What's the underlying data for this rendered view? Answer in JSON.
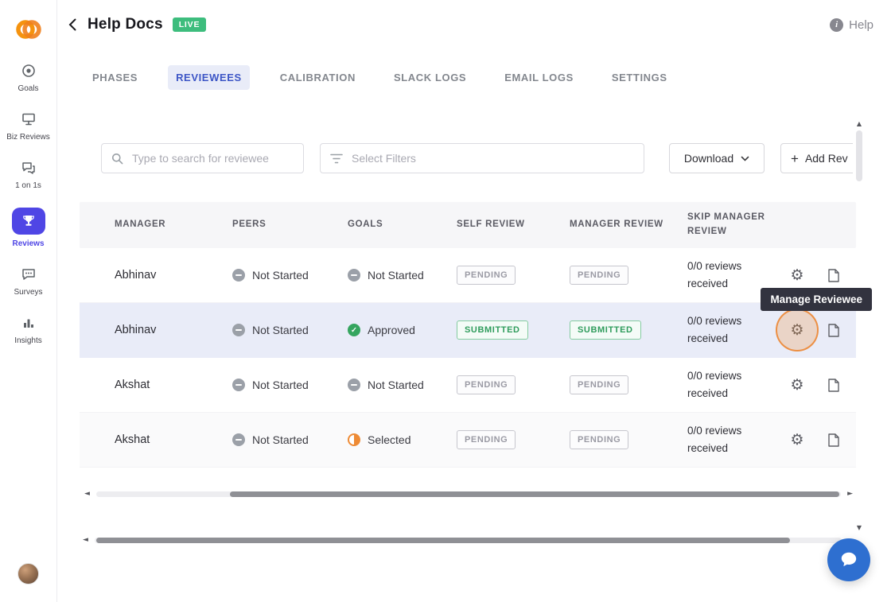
{
  "colors": {
    "nav-active": "#4f46e5",
    "tab-active": "#3d56c6",
    "live-green": "#3dbd7d",
    "submitted-green": "#2f9c5c",
    "highlight-orange": "#ee8b35",
    "chat-blue": "#2e6fd0",
    "logo-orange": "#f0851d"
  },
  "icons": {
    "gear": "⚙",
    "plus": "+",
    "info": "i",
    "scroll_up": "▲",
    "scroll_down": "▼",
    "scroll_left": "◄",
    "scroll_right": "►"
  },
  "sidebar": {
    "items": [
      {
        "label": "Goals",
        "active": false
      },
      {
        "label": "Biz Reviews",
        "active": false
      },
      {
        "label": "1 on 1s",
        "active": false
      },
      {
        "label": "Reviews",
        "active": true
      },
      {
        "label": "Surveys",
        "active": false
      },
      {
        "label": "Insights",
        "active": false
      }
    ]
  },
  "header": {
    "title": "Help Docs",
    "live_badge": "LIVE",
    "help_label": "Help"
  },
  "tabs": [
    {
      "label": "PHASES",
      "active": false
    },
    {
      "label": "REVIEWEES",
      "active": true
    },
    {
      "label": "CALIBRATION",
      "active": false
    },
    {
      "label": "SLACK LOGS",
      "active": false
    },
    {
      "label": "EMAIL LOGS",
      "active": false
    },
    {
      "label": "SETTINGS",
      "active": false
    }
  ],
  "toolbar": {
    "search_placeholder": "Type to search for reviewee",
    "filter_placeholder": "Select Filters",
    "download_label": "Download",
    "add_reviewee_label": "Add Rev"
  },
  "table": {
    "columns": [
      "MANAGER",
      "PEERS",
      "GOALS",
      "SELF REVIEW",
      "MANAGER REVIEW",
      "SKIP MANAGER REVIEW"
    ],
    "rows": [
      {
        "manager": "Abhinav",
        "peers": {
          "label": "Not Started",
          "status": "not-started"
        },
        "goals": {
          "label": "Not Started",
          "status": "not-started"
        },
        "self_review": "PENDING",
        "manager_review": "PENDING",
        "skip_manager_review": "0/0 reviews received",
        "highlighted": false
      },
      {
        "manager": "Abhinav",
        "peers": {
          "label": "Not Started",
          "status": "not-started"
        },
        "goals": {
          "label": "Approved",
          "status": "approved"
        },
        "self_review": "SUBMITTED",
        "manager_review": "SUBMITTED",
        "skip_manager_review": "0/0 reviews received",
        "highlighted": true
      },
      {
        "manager": "Akshat",
        "peers": {
          "label": "Not Started",
          "status": "not-started"
        },
        "goals": {
          "label": "Not Started",
          "status": "not-started"
        },
        "self_review": "PENDING",
        "manager_review": "PENDING",
        "skip_manager_review": "0/0 reviews received",
        "highlighted": false
      },
      {
        "manager": "Akshat",
        "peers": {
          "label": "Not Started",
          "status": "not-started"
        },
        "goals": {
          "label": "Selected",
          "status": "selected"
        },
        "self_review": "PENDING",
        "manager_review": "PENDING",
        "skip_manager_review": "0/0 reviews received",
        "highlighted": false
      }
    ]
  },
  "tooltip": {
    "text": "Manage Reviewee"
  }
}
